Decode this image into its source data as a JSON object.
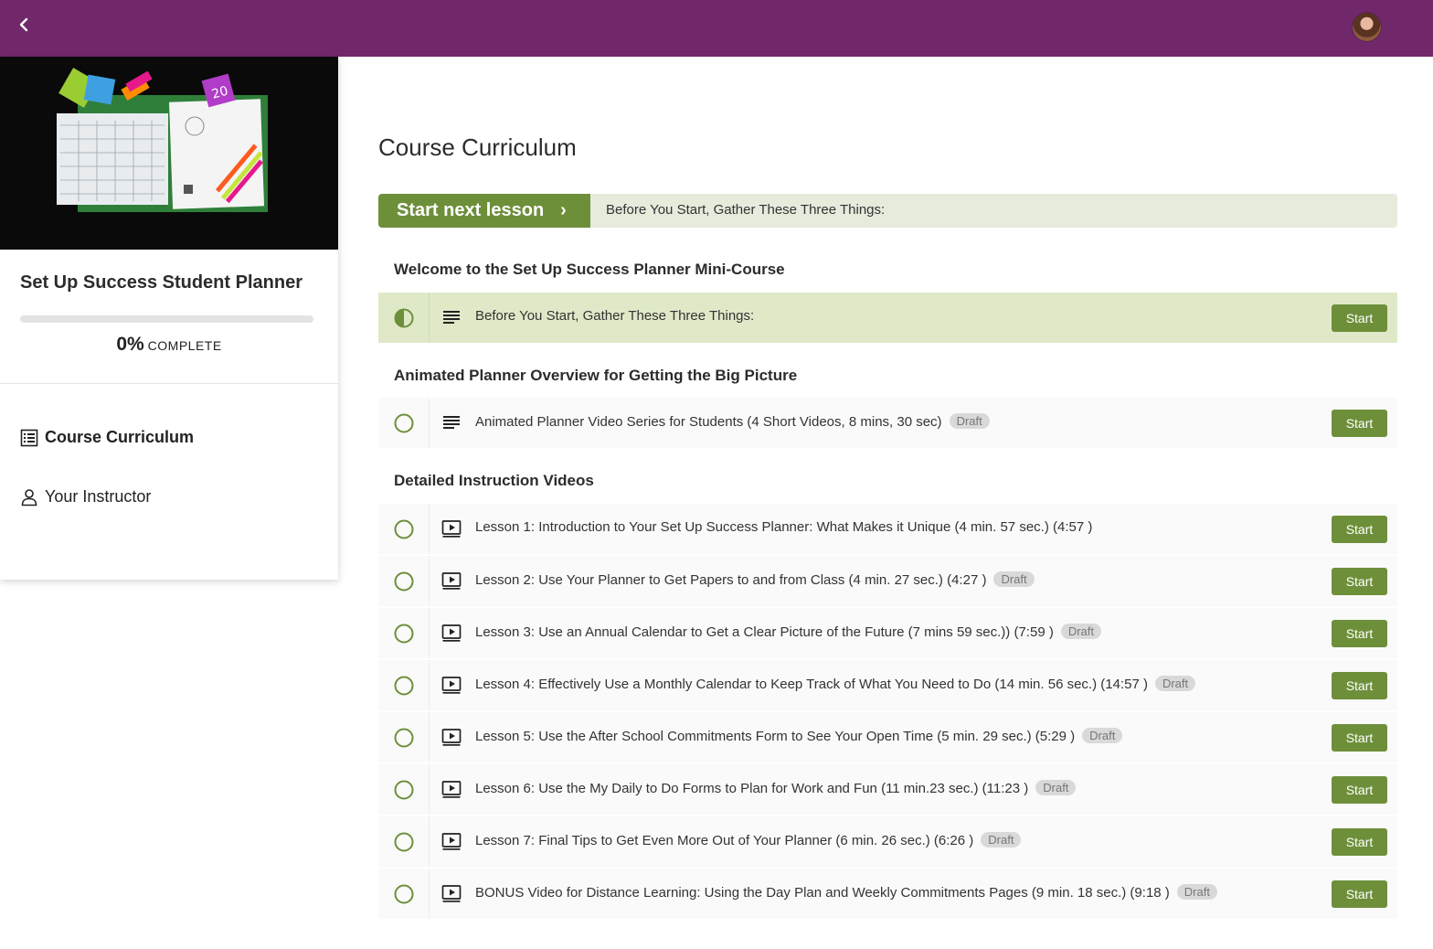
{
  "header": {
    "back_icon": "chevron-left-icon",
    "avatar_icon": "user-avatar"
  },
  "sidebar": {
    "course_title": "Set Up Success Student Planner",
    "progress_percent": 0,
    "progress_value": "0%",
    "progress_word": "COMPLETE",
    "nav": [
      {
        "label": "Course Curriculum",
        "icon": "curriculum-list-icon"
      },
      {
        "label": "Your Instructor",
        "icon": "person-icon"
      }
    ]
  },
  "main": {
    "title": "Course Curriculum",
    "next_lesson_button": "Start next lesson",
    "next_lesson_title": "Before You Start, Gather These Three Things:",
    "sections": [
      {
        "title": "Welcome to the Set Up Success Planner Mini-Course",
        "lectures": [
          {
            "name": "Before You Start, Gather These Three Things:",
            "type": "text",
            "badge": "",
            "status": "in-progress",
            "button": "Start"
          }
        ]
      },
      {
        "title": "Animated Planner Overview for Getting the Big Picture",
        "lectures": [
          {
            "name": "Animated Planner Video Series for Students (4 Short Videos, 8 mins, 30 sec)",
            "type": "text",
            "badge": "Draft",
            "status": "not-started",
            "button": "Start"
          }
        ]
      },
      {
        "title": "Detailed Instruction Videos",
        "lectures": [
          {
            "name": "Lesson 1: Introduction to Your Set Up Success Planner: What Makes it Unique (4 min. 57 sec.) (4:57 )",
            "type": "video",
            "badge": "",
            "status": "not-started",
            "button": "Start"
          },
          {
            "name": "Lesson 2: Use Your Planner to Get Papers to and from Class (4 min. 27 sec.) (4:27 )",
            "type": "video",
            "badge": "Draft",
            "status": "not-started",
            "button": "Start"
          },
          {
            "name": "Lesson 3: Use an Annual Calendar to Get a Clear Picture of the Future (7 mins 59 sec.)) (7:59 )",
            "type": "video",
            "badge": "Draft",
            "status": "not-started",
            "button": "Start"
          },
          {
            "name": "Lesson 4: Effectively Use a Monthly Calendar to Keep Track of What You Need to Do (14 min. 56 sec.) (14:57 )",
            "type": "video",
            "badge": "Draft",
            "status": "not-started",
            "button": "Start"
          },
          {
            "name": "Lesson 5: Use the After School Commitments Form to See Your Open Time (5 min. 29 sec.) (5:29 )",
            "type": "video",
            "badge": "Draft",
            "status": "not-started",
            "button": "Start"
          },
          {
            "name": "Lesson 6: Use the My Daily to Do Forms to Plan for Work and Fun (11 min.23 sec.) (11:23 )",
            "type": "video",
            "badge": "Draft",
            "status": "not-started",
            "button": "Start"
          },
          {
            "name": "Lesson 7: Final Tips to Get Even More Out of Your Planner (6 min. 26 sec.) (6:26 )",
            "type": "video",
            "badge": "Draft",
            "status": "not-started",
            "button": "Start"
          },
          {
            "name": "BONUS Video for Distance Learning: Using the Day Plan and Weekly Commitments Pages (9 min. 18 sec.) (9:18 )",
            "type": "video",
            "badge": "Draft",
            "status": "not-started",
            "button": "Start"
          }
        ]
      }
    ]
  },
  "colors": {
    "header_bg": "#71286b",
    "accent_green": "#6e8f3a",
    "active_row_bg": "#dfe9c8",
    "next_bar_bg": "#e6ebdc"
  }
}
